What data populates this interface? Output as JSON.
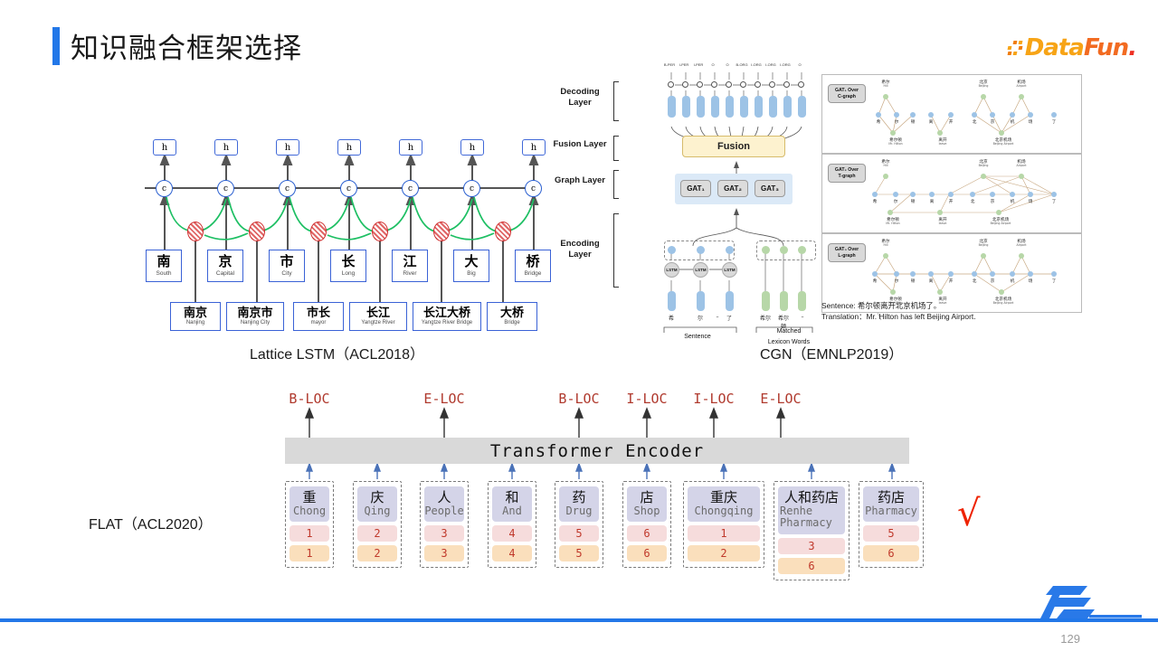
{
  "header": {
    "title": "知识融合框架选择",
    "accent_color": "#2277e8",
    "logo": {
      "part1": "Data",
      "part2": "Fun",
      "part3": "."
    }
  },
  "footer": {
    "page_number": "129",
    "rule_color": "#2277e8",
    "logo_name": "TME"
  },
  "lattice": {
    "caption": "Lattice LSTM（ACL2018）",
    "hidden_label": "h",
    "cell_label": "c",
    "chars": [
      {
        "zh": "南",
        "en": "South"
      },
      {
        "zh": "京",
        "en": "Capital"
      },
      {
        "zh": "市",
        "en": "City"
      },
      {
        "zh": "长",
        "en": "Long"
      },
      {
        "zh": "江",
        "en": "River"
      },
      {
        "zh": "大",
        "en": "Big"
      },
      {
        "zh": "桥",
        "en": "Bridge"
      }
    ],
    "words": [
      {
        "zh": "南京",
        "en": "Nanjing"
      },
      {
        "zh": "南京市",
        "en": "Nanjing City"
      },
      {
        "zh": "市长",
        "en": "mayor"
      },
      {
        "zh": "长江",
        "en": "Yangtze River"
      },
      {
        "zh": "长江大桥",
        "en": "Yangtze River Bridge"
      },
      {
        "zh": "大桥",
        "en": "Bridge"
      }
    ]
  },
  "cgn": {
    "caption": "CGN（EMNLP2019）",
    "layers": [
      "Decoding\nLayer",
      "Fusion\nLayer",
      "Graph\nLayer",
      "Encoding\nLayer"
    ],
    "layer_decoding": "Decoding Layer",
    "layer_fusion": "Fusion Layer",
    "layer_graph": "Graph Layer",
    "layer_encoding": "Encoding Layer",
    "fusion_label": "Fusion",
    "gats": [
      "GAT₁",
      "GAT₂",
      "GAT₃"
    ],
    "bio_tags": [
      "B-PER",
      "I-PER",
      "I-PER",
      "O",
      "O",
      "B-ORG",
      "I-ORG",
      "I-ORG",
      "I-ORG",
      "O"
    ],
    "lstm_label": "LSTM",
    "sentence_chars": [
      "希",
      "尔",
      "–",
      "了"
    ],
    "lexicon_words": [
      {
        "zh": "希尔",
        "en": "Hill"
      },
      {
        "zh": "希尔顿",
        "en": "Mr. Hilton"
      },
      {
        "zh": "–",
        "en": ""
      }
    ],
    "sentence_caption": "Sentence",
    "lexicon_caption": "Matched\nLexicon Words",
    "lexicon_caption_1": "Matched",
    "lexicon_caption_2": "Lexicon Words",
    "graph_panels": [
      {
        "tag_line1": "GAT₁ Over",
        "tag_line2": "C-graph"
      },
      {
        "tag_line1": "GAT₂ Over",
        "tag_line2": "T-graph"
      },
      {
        "tag_line1": "GAT₃ Over",
        "tag_line2": "L-graph"
      }
    ],
    "graph_chars": [
      "希",
      "尔",
      "顿",
      "离",
      "开",
      "北",
      "京",
      "机",
      "场",
      "了"
    ],
    "graph_top_words": [
      {
        "zh": "希尔",
        "en": "Hill"
      },
      {
        "zh": "北京",
        "en": "Beijing"
      },
      {
        "zh": "机场",
        "en": "Airport"
      }
    ],
    "graph_bottom_words": [
      {
        "zh": "希尔顿",
        "en": "Mr. Hilton"
      },
      {
        "zh": "离开",
        "en": "leave"
      },
      {
        "zh": "北京机场",
        "en": "Beijing Airport"
      }
    ],
    "sentence_note": "Sentence: 希尔顿离开北京机场了。",
    "translation_note": "Translation：Mr. Hilton has left Beijing Airport."
  },
  "flat": {
    "label": "FLAT（ACL2020）",
    "encoder_label": "Transformer Encoder",
    "tags": [
      "B-LOC",
      "E-LOC",
      "B-LOC",
      "I-LOC",
      "I-LOC",
      "E-LOC"
    ],
    "tag_color": "#b03a2e",
    "check_mark": "√",
    "tokens": [
      {
        "zh": "重",
        "en": "Chong",
        "head": "1",
        "tail": "1"
      },
      {
        "zh": "庆",
        "en": "Qing",
        "head": "2",
        "tail": "2"
      },
      {
        "zh": "人",
        "en": "People",
        "head": "3",
        "tail": "3"
      },
      {
        "zh": "和",
        "en": "And",
        "head": "4",
        "tail": "4"
      },
      {
        "zh": "药",
        "en": "Drug",
        "head": "5",
        "tail": "5"
      },
      {
        "zh": "店",
        "en": "Shop",
        "head": "6",
        "tail": "6"
      },
      {
        "zh": "重庆",
        "en": "Chongqing",
        "head": "1",
        "tail": "2"
      },
      {
        "zh": "人和药店",
        "en": "Renhe Pharmacy",
        "head": "3",
        "tail": "6"
      },
      {
        "zh": "药店",
        "en": "Pharmacy",
        "head": "5",
        "tail": "6"
      }
    ]
  }
}
